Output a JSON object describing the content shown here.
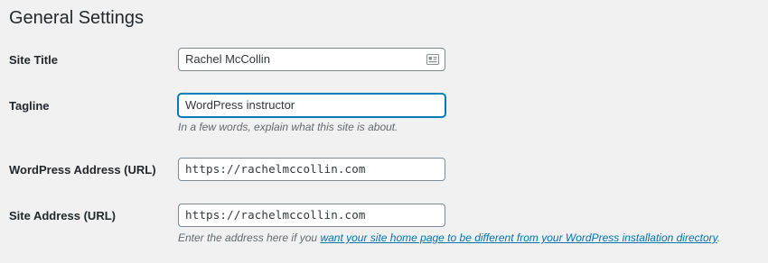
{
  "page": {
    "title": "General Settings"
  },
  "site_title": {
    "label": "Site Title",
    "value": "Rachel McCollin",
    "icon": "contact-card-icon"
  },
  "tagline": {
    "label": "Tagline",
    "value": "WordPress instructor",
    "description": "In a few words, explain what this site is about."
  },
  "wp_address": {
    "label": "WordPress Address (URL)",
    "value": "https://rachelmccollin.com"
  },
  "site_address": {
    "label": "Site Address (URL)",
    "value": "https://rachelmccollin.com",
    "description_prefix": "Enter the address here if you ",
    "description_link": "want your site home page to be different from your WordPress installation directory",
    "description_suffix": "."
  },
  "colors": {
    "background": "#f1f1f1",
    "focus_border": "#007cba",
    "link": "#0073aa",
    "description_text": "#646970"
  }
}
